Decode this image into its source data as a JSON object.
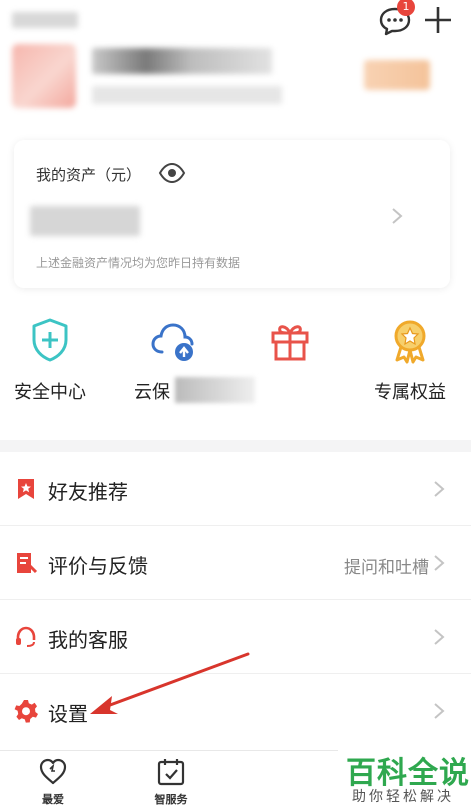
{
  "header": {
    "message_icon": "chat-bubble-icon",
    "message_badge": "1",
    "add_icon": "plus-icon"
  },
  "assets": {
    "title": "我的资产（元）",
    "eye_icon": "eye-icon",
    "note": "上述金融资产情况均为您昨日持有数据"
  },
  "quick_actions": [
    {
      "label": "安全中心",
      "icon": "shield-plus-icon",
      "color": "#3cc4c4"
    },
    {
      "label": "云保",
      "icon": "cloud-upload-icon",
      "color": "#3a73c9"
    },
    {
      "label": "",
      "icon": "gift-icon",
      "color": "#e8534a"
    },
    {
      "label": "专属权益",
      "icon": "medal-icon",
      "color": "#f0a92b"
    }
  ],
  "menu": {
    "items": [
      {
        "label": "好友推荐",
        "extra": "",
        "icon": "bookmark-star-icon"
      },
      {
        "label": "评价与反馈",
        "extra": "提问和吐槽",
        "icon": "feedback-icon"
      },
      {
        "label": "我的客服",
        "extra": "",
        "icon": "headset-icon"
      },
      {
        "label": "设置",
        "extra": "",
        "icon": "gear-icon"
      }
    ],
    "accent": "#e8453c"
  },
  "tabbar": {
    "items": [
      {
        "label": "最爱",
        "icon": "heart-icon"
      },
      {
        "label": "智服务",
        "icon": "calendar-check-icon"
      }
    ]
  },
  "watermark": {
    "title": "百科全说",
    "subtitle": "助你轻松解决"
  }
}
